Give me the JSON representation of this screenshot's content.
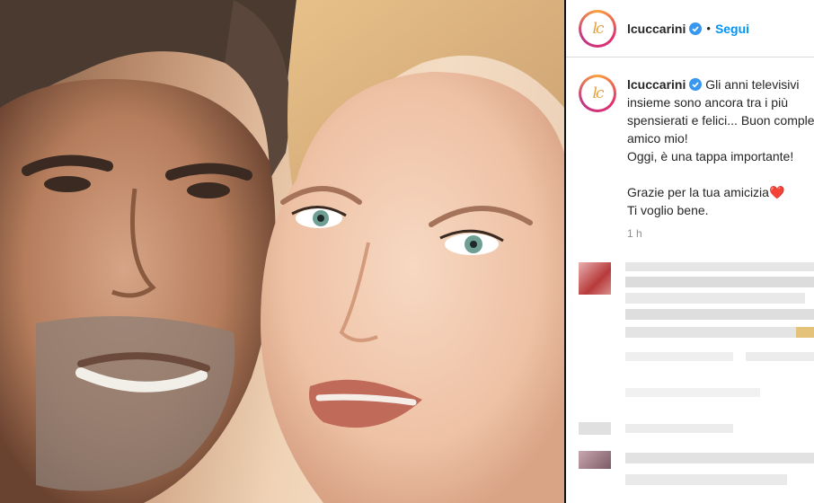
{
  "post": {
    "username": "lcuccarini",
    "follow_label": "Segui",
    "separator": "•",
    "avatar_text": "lc",
    "caption_lines": [
      "Gli anni televisivi",
      "insieme sono ancora tra i più",
      "spensierati e felici... Buon compleanno",
      "amico mio!",
      "Oggi, è una tappa importante!"
    ],
    "caption_lines_2": [
      "Grazie per la tua amicizia",
      "Ti voglio bene."
    ],
    "heart_emoji": "❤️",
    "time": "1 h"
  },
  "colors": {
    "follow_blue": "#0095f6",
    "verified_blue": "#3897f0",
    "heart_red": "#ed1c2e",
    "muted_gray": "#8e8e8e"
  },
  "icons": {
    "verified": "verified-badge-icon",
    "avatar_ring": "story-ring"
  }
}
